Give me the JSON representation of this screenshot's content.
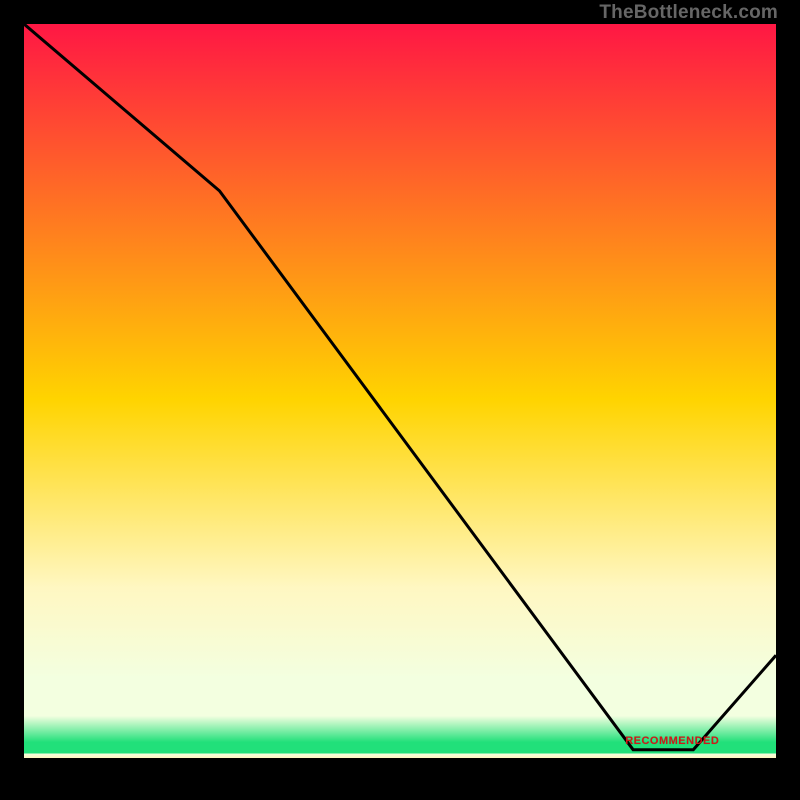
{
  "watermark": "TheBottleneck.com",
  "band_label": "RECOMMENDED",
  "colors": {
    "top": "#ff1744",
    "mid": "#ffd400",
    "lower_cream": "#fff7c2",
    "pale": "#f3ffe0",
    "green": "#21e07a",
    "line": "#000000",
    "label": "#d01818"
  },
  "chart_data": {
    "type": "line",
    "title": "",
    "xlabel": "",
    "ylabel": "",
    "xlim": [
      0,
      100
    ],
    "ylim": [
      0,
      100
    ],
    "x": [
      0,
      26,
      81,
      89,
      100
    ],
    "values": [
      100,
      77,
      0,
      0,
      13
    ],
    "gradient_stops_pct": [
      0,
      50,
      75,
      87,
      92,
      95.5,
      97
    ],
    "recommended_band_x": [
      81,
      89
    ],
    "recommended_label_y_pct": 95.3
  }
}
